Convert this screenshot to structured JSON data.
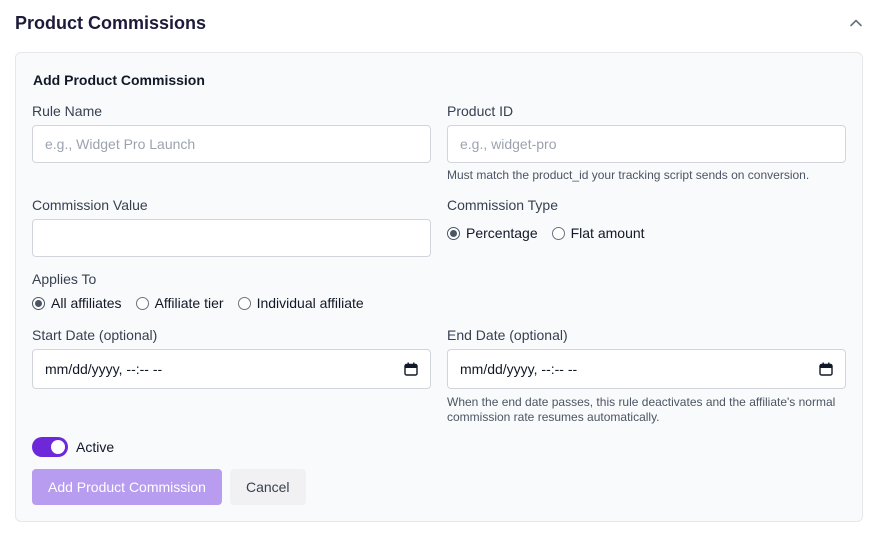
{
  "header": {
    "title": "Product Commissions",
    "collapse_icon": "chevron-up-icon"
  },
  "form": {
    "title": "Add Product Commission",
    "rule_name": {
      "label": "Rule Name",
      "placeholder": "e.g., Widget Pro Launch",
      "value": ""
    },
    "product_id": {
      "label": "Product ID",
      "placeholder": "e.g., widget-pro",
      "value": "",
      "hint": "Must match the product_id your tracking script sends on conversion."
    },
    "commission_value": {
      "label": "Commission Value",
      "value": ""
    },
    "commission_type": {
      "label": "Commission Type",
      "options": [
        "Percentage",
        "Flat amount"
      ],
      "selected": "Percentage"
    },
    "applies_to": {
      "label": "Applies To",
      "options": [
        "All affiliates",
        "Affiliate tier",
        "Individual affiliate"
      ],
      "selected": "All affiliates"
    },
    "start_date": {
      "label": "Start Date (optional)",
      "value": "mm/dd/yyyy, --:-- --"
    },
    "end_date": {
      "label": "End Date (optional)",
      "value": "mm/dd/yyyy, --:-- --",
      "hint_line1": "When the end date passes, this rule deactivates and the affiliate's normal",
      "hint_line2": "commission rate resumes automatically."
    },
    "active": {
      "label": "Active",
      "on": true
    },
    "submit_label": "Add Product Commission",
    "cancel_label": "Cancel"
  },
  "colors": {
    "accent": "#6d28d9",
    "submit_disabled": "#b79cf0"
  }
}
